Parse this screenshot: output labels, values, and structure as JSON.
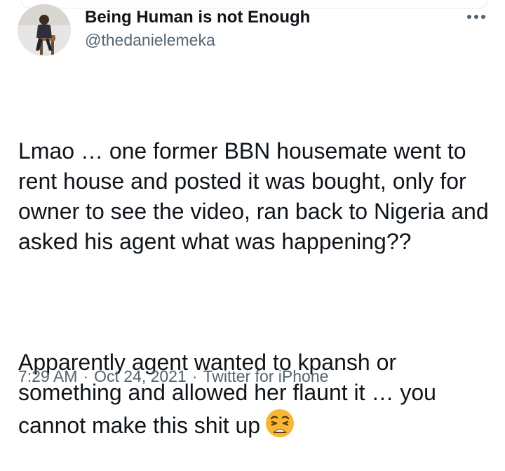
{
  "author": {
    "display_name": "Being Human is not Enough",
    "handle": "@thedanielemeka",
    "avatar_icon": "profile-photo"
  },
  "menu": {
    "icon": "more-horizontal-icon"
  },
  "tweet": {
    "paragraph_1": "Lmao … one former BBN housemate went to rent house and posted it was bought, only for owner to see the video, ran back to Nigeria and asked his agent what was happening??",
    "paragraph_2": "Apparently agent wanted to kpansh or something and allowed her flaunt it … you cannot make this shit up",
    "emoji": "weary-face-emoji"
  },
  "meta": {
    "time": "7:29 AM",
    "separator": "·",
    "date": "Oct 24, 2021",
    "source": "Twitter for iPhone"
  },
  "colors": {
    "text_primary": "#0f1419",
    "text_secondary": "#536471",
    "emoji_yellow": "#f7b733"
  }
}
